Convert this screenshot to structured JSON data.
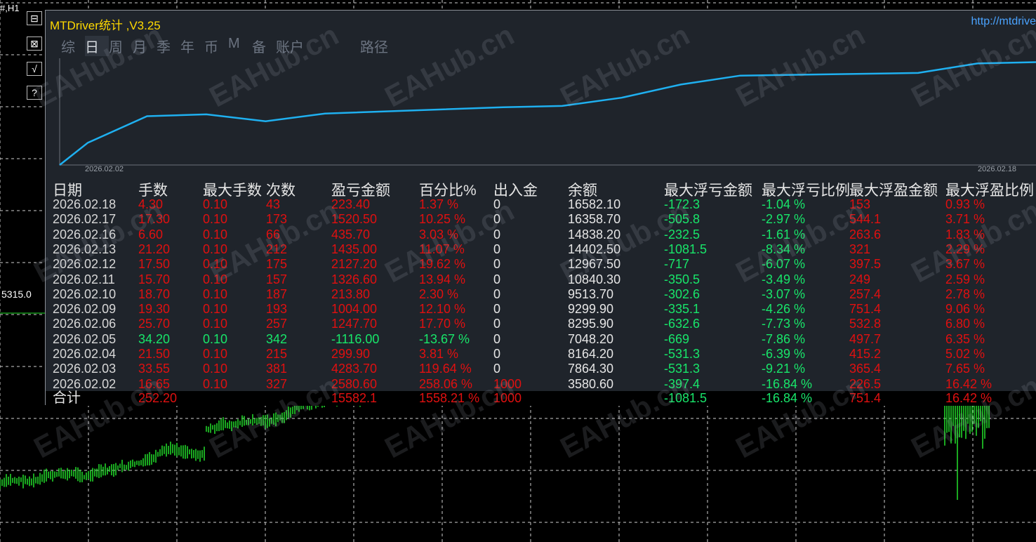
{
  "chart": {
    "symbol_label": "#,H1",
    "price_label": "5315.0"
  },
  "toolbar": {
    "btn1": "⊟",
    "btn2": "⊠",
    "btn3": "√",
    "btn4": "?"
  },
  "panel": {
    "title": "MTDriver统计 ,V3.25",
    "url": "http://mtdrive",
    "tabs": [
      "综",
      "日",
      "周",
      "月",
      "季",
      "年",
      "币",
      "M",
      "备",
      "账户"
    ],
    "active_tab_index": 1,
    "path_tab": "路径",
    "date_start": "2026.02.02",
    "date_end": "2026.02.18"
  },
  "table": {
    "headers": [
      "日期",
      "手数",
      "最大手数",
      "次数",
      "盈亏金额",
      "百分比%",
      "出入金",
      "余额",
      "最大浮亏金额",
      "最大浮亏比例",
      "最大浮盈金额",
      "最大浮盈比例"
    ],
    "rows": [
      [
        "2026.02.18",
        "4.30",
        "0.10",
        "43",
        "223.40",
        "1.37 %",
        "0",
        "16582.10",
        "-172.3",
        "-1.04 %",
        "153",
        "0.93 %"
      ],
      [
        "2026.02.17",
        "17.30",
        "0.10",
        "173",
        "1520.50",
        "10.25 %",
        "0",
        "16358.70",
        "-505.8",
        "-2.97 %",
        "544.1",
        "3.71 %"
      ],
      [
        "2026.02.16",
        "6.60",
        "0.10",
        "66",
        "435.70",
        "3.03 %",
        "0",
        "14838.20",
        "-232.5",
        "-1.61 %",
        "263.6",
        "1.83 %"
      ],
      [
        "2026.02.13",
        "21.20",
        "0.10",
        "212",
        "1435.00",
        "11.07 %",
        "0",
        "14402.50",
        "-1081.5",
        "-8.34 %",
        "321",
        "2.29 %"
      ],
      [
        "2026.02.12",
        "17.50",
        "0.10",
        "175",
        "2127.20",
        "19.62 %",
        "0",
        "12967.50",
        "-717",
        "-6.07 %",
        "397.5",
        "3.67 %"
      ],
      [
        "2026.02.11",
        "15.70",
        "0.10",
        "157",
        "1326.60",
        "13.94 %",
        "0",
        "10840.30",
        "-350.5",
        "-3.49 %",
        "249",
        "2.59 %"
      ],
      [
        "2026.02.10",
        "18.70",
        "0.10",
        "187",
        "213.80",
        "2.30 %",
        "0",
        "9513.70",
        "-302.6",
        "-3.07 %",
        "257.4",
        "2.78 %"
      ],
      [
        "2026.02.09",
        "19.30",
        "0.10",
        "193",
        "1004.00",
        "12.10 %",
        "0",
        "9299.90",
        "-335.1",
        "-4.26 %",
        "751.4",
        "9.06 %"
      ],
      [
        "2026.02.06",
        "25.70",
        "0.10",
        "257",
        "1247.70",
        "17.70 %",
        "0",
        "8295.90",
        "-632.6",
        "-7.73 %",
        "532.8",
        "6.80 %"
      ],
      [
        "2026.02.05",
        "34.20",
        "0.10",
        "342",
        "-1116.00",
        "-13.67 %",
        "0",
        "7048.20",
        "-669",
        "-7.86 %",
        "497.7",
        "6.35 %"
      ],
      [
        "2026.02.04",
        "21.50",
        "0.10",
        "215",
        "299.90",
        "3.81 %",
        "0",
        "8164.20",
        "-531.3",
        "-6.39 %",
        "415.2",
        "5.02 %"
      ],
      [
        "2026.02.03",
        "33.55",
        "0.10",
        "381",
        "4283.70",
        "119.64 %",
        "0",
        "7864.30",
        "-531.3",
        "-9.21 %",
        "365.4",
        "7.65 %"
      ],
      [
        "2026.02.02",
        "16.65",
        "0.10",
        "327",
        "2580.60",
        "258.06 %",
        "1000",
        "3580.60",
        "-397.4",
        "-16.84 %",
        "226.5",
        "16.42 %"
      ]
    ],
    "row_green": [
      false,
      false,
      false,
      false,
      false,
      false,
      false,
      false,
      false,
      true,
      false,
      false,
      false
    ],
    "total": {
      "label": "合计",
      "lots": "252.20",
      "profit": "15582.1",
      "percent": "1558.21 %",
      "deposit": "1000",
      "max_float_loss": "-1081.5",
      "max_float_loss_pct": "-16.84 %",
      "max_float_profit": "751.4",
      "max_float_profit_pct": "16.42 %"
    }
  },
  "watermark": "EAHub.cn",
  "colors": {
    "curve": "#1fb0f0",
    "profit": "#e01010",
    "loss": "#18e66a",
    "title": "#ffd900",
    "url": "#4aa3ff"
  },
  "curve_data": {
    "x_dates": [
      "2026.02.02",
      "2026.02.03",
      "2026.02.04",
      "2026.02.05",
      "2026.02.06",
      "2026.02.09",
      "2026.02.10",
      "2026.02.11",
      "2026.02.12",
      "2026.02.13",
      "2026.02.16",
      "2026.02.17",
      "2026.02.18"
    ],
    "balance": [
      3580.6,
      7864.3,
      8164.2,
      7048.2,
      8295.9,
      9299.9,
      9513.7,
      10840.3,
      12967.5,
      14402.5,
      14838.2,
      16358.7,
      16582.1
    ]
  }
}
